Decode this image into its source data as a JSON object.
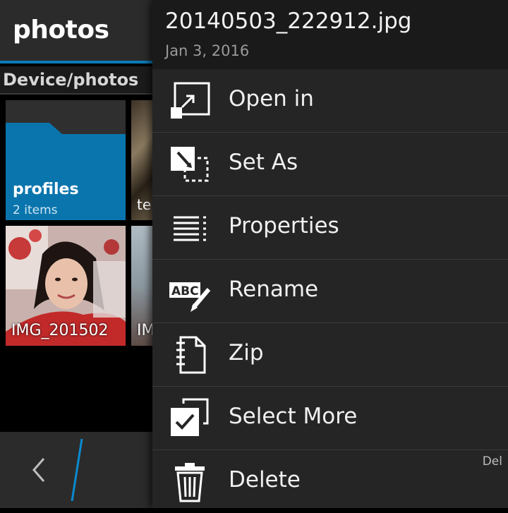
{
  "app": {
    "title": "photos",
    "path": "Device/photos"
  },
  "grid": {
    "folder": {
      "name": "profiles",
      "count": "2 items"
    },
    "items": [
      {
        "label": "te"
      },
      {
        "label": "IMG_201502"
      },
      {
        "label": "IM"
      }
    ]
  },
  "panel": {
    "file_name": "20140503_222912.jpg",
    "file_date": "Jan 3, 2016",
    "items": [
      {
        "label": "Open in",
        "icon": "open-in-icon"
      },
      {
        "label": "Set As",
        "icon": "set-as-icon"
      },
      {
        "label": "Properties",
        "icon": "properties-icon"
      },
      {
        "label": "Rename",
        "icon": "rename-icon"
      },
      {
        "label": "Zip",
        "icon": "zip-icon"
      },
      {
        "label": "Select More",
        "icon": "select-more-icon"
      },
      {
        "label": "Delete",
        "icon": "delete-icon",
        "shortcut": "Del"
      }
    ]
  },
  "colors": {
    "accent": "#0a7bb8",
    "panel_bg": "#252525",
    "header_bg": "#1a1a1a"
  }
}
